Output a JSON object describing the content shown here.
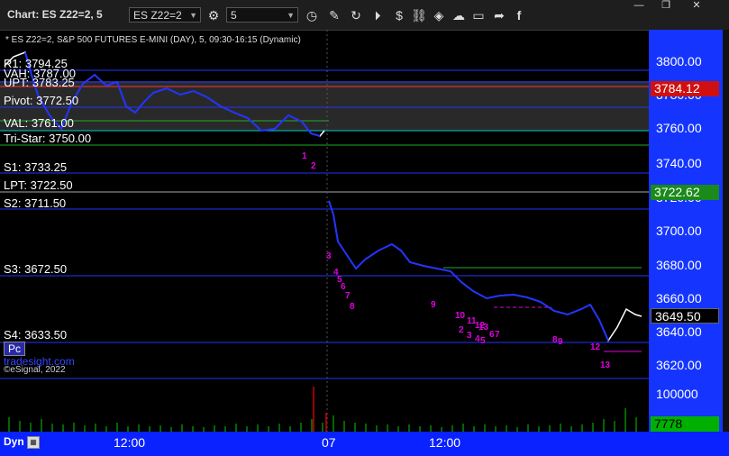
{
  "window": {
    "title": "Chart: ES Z22=2, 5",
    "symbol": "ES Z22=2",
    "interval": "5",
    "controls": {
      "minimize": "—",
      "restore": "❐",
      "close": "✕"
    }
  },
  "chart": {
    "description": "* ES Z22=2, S&P 500 FUTURES E-MINI (DAY), 5, 09:30-16:15 (Dynamic)",
    "copyright": "©eSignal, 2022",
    "watermark": "tradesight.com",
    "pc_label": "Pc",
    "levels": [
      {
        "label": "R",
        "price": "3794.25"
      },
      {
        "label": "VAH",
        "price": "3787.00"
      },
      {
        "label": "UPT",
        "price": "3783.25"
      },
      {
        "label": "Pivot",
        "price": "3772.50"
      },
      {
        "label": "VAL",
        "price": "3761.00"
      },
      {
        "label": "Tri-Star",
        "price": "3750.00"
      },
      {
        "label": "S1",
        "price": "3733.25"
      },
      {
        "label": "LPT",
        "price": "3722.50"
      },
      {
        "label": "S2",
        "price": "3711.50"
      },
      {
        "label": "S3",
        "price": "3672.50"
      },
      {
        "label": "S4",
        "price": "3633.50"
      }
    ],
    "level_text": {
      "r": "R1: 3794.25",
      "vah": "VAH: 3787.00",
      "upt": "UPT: 3783.25",
      "pivot": "Pivot: 3772.50",
      "val": "VAL: 3761.00",
      "tristar": "Tri-Star: 3750.00",
      "s1": "S1: 3733.25",
      "lpt": "LPT: 3722.50",
      "s2": "S2: 3711.50",
      "s3": "S3: 3672.50",
      "s4": "S4: 3633.50"
    },
    "price_axis": [
      "3800.00",
      "3780.00",
      "3760.00",
      "3740.00",
      "3720.00",
      "3700.00",
      "3680.00",
      "3660.00",
      "3640.00",
      "3620.00"
    ],
    "volume_axis": [
      "100000"
    ],
    "price_markers": {
      "upper": "3784.12",
      "lpt": "3722.62",
      "last": "3649.50",
      "volume": "7778"
    },
    "time_axis": [
      "12:00",
      "07",
      "12:00"
    ],
    "bottom_label": "Dyn",
    "counts": [
      {
        "text": "1",
        "color": "#e000e0"
      },
      {
        "text": "2",
        "color": "#e000e0"
      },
      {
        "text": "3",
        "color": "#e000e0"
      },
      {
        "text": "4",
        "color": "#e000e0"
      },
      {
        "text": "5",
        "color": "#e000e0"
      },
      {
        "text": "6",
        "color": "#e000e0"
      },
      {
        "text": "7",
        "color": "#e000e0"
      },
      {
        "text": "8",
        "color": "#e000e0"
      },
      {
        "text": "9",
        "color": "#e000e0"
      },
      {
        "text": "10",
        "color": "#e000e0"
      },
      {
        "text": "11",
        "color": "#e000e0"
      },
      {
        "text": "12",
        "color": "#e000e0"
      },
      {
        "text": "13",
        "color": "#e000e0"
      },
      {
        "text": "2",
        "color": "#e000e0"
      },
      {
        "text": "3",
        "color": "#e000e0"
      },
      {
        "text": "4",
        "color": "#e000e0"
      },
      {
        "text": "5",
        "color": "#e000e0"
      },
      {
        "text": "6",
        "color": "#e000e0"
      },
      {
        "text": "7",
        "color": "#e000e0"
      },
      {
        "text": "8",
        "color": "#e000e0"
      },
      {
        "text": "9",
        "color": "#e000e0"
      },
      {
        "text": "12",
        "color": "#e000e0"
      },
      {
        "text": "13",
        "color": "#e000e0"
      }
    ],
    "colors": {
      "background": "#000000",
      "price_axis": "#1535ff",
      "candle": "#ffffff",
      "candle_down": "#2233ff",
      "level_line": "#2233ff",
      "green_line": "#22aa22",
      "red_line": "#ff3333",
      "volume": "#00cc00",
      "count_magenta": "#e000e0",
      "count_green": "#00aa00"
    }
  }
}
